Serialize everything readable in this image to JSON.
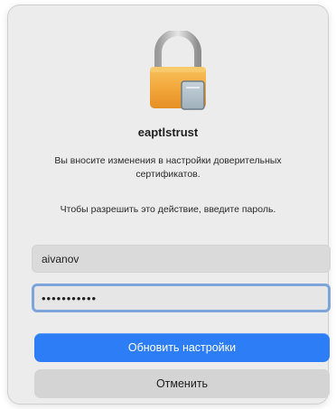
{
  "dialog": {
    "icon": "padlock-certificate-icon",
    "title": "eaptlstrust",
    "message": "Вы вносите изменения в настройки доверительных сертификатов.",
    "prompt": "Чтобы разрешить это действие, введите пароль.",
    "username_value": "aivanov",
    "password_value": "•••••••••••",
    "primary_button": "Обновить настройки",
    "cancel_button": "Отменить"
  },
  "colors": {
    "accent": "#2d7df6",
    "lock_gold": "#f2a63a",
    "focus_ring": "#7ea4dc"
  }
}
